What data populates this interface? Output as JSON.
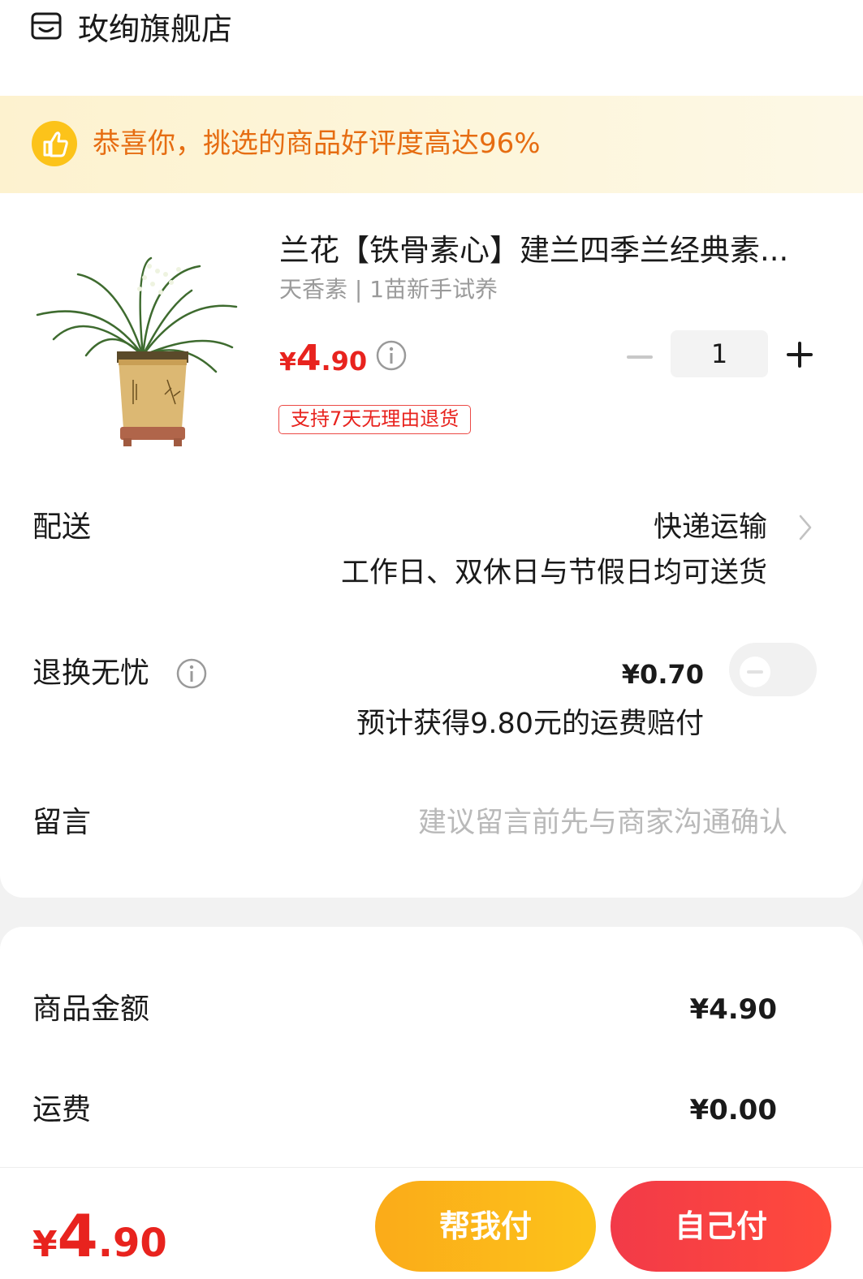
{
  "header": {
    "store_icon": "store-icon",
    "store_name": "玫绚旗舰店"
  },
  "banner": {
    "icon": "thumbs-up-icon",
    "text": "恭喜你，挑选的商品好评度高达96%",
    "color": "#e66d12"
  },
  "product": {
    "title": "兰花【铁骨素心】建兰四季兰经典素...",
    "spec": "天香素 | 1苗新手试养",
    "price": {
      "currency": "¥",
      "integer": "4",
      "decimal": ".90"
    },
    "price_info_icon": "info-icon",
    "quantity": "1",
    "return_tag": "支持7天无理由退货"
  },
  "delivery": {
    "label": "配送",
    "method": "快递运输",
    "description": "工作日、双休日与节假日均可送货"
  },
  "return_worry_free": {
    "label": "退换无忧",
    "price": "¥0.70",
    "description": "预计获得9.80元的运费赔付",
    "toggle_on": false
  },
  "message": {
    "label": "留言",
    "placeholder": "建议留言前先与商家沟通确认",
    "value": ""
  },
  "summary": {
    "goods_amount_label": "商品金额",
    "goods_amount_value": "¥4.90",
    "shipping_label": "运费",
    "shipping_value": "¥0.00"
  },
  "footer": {
    "total": {
      "currency": "¥",
      "integer": "4",
      "decimal": ".90"
    },
    "help_pay_label": "帮我付",
    "self_pay_label": "自己付"
  },
  "colors": {
    "price_red": "#e8231e",
    "help_btn": "#fbb81a",
    "self_btn": "#f23a48"
  }
}
